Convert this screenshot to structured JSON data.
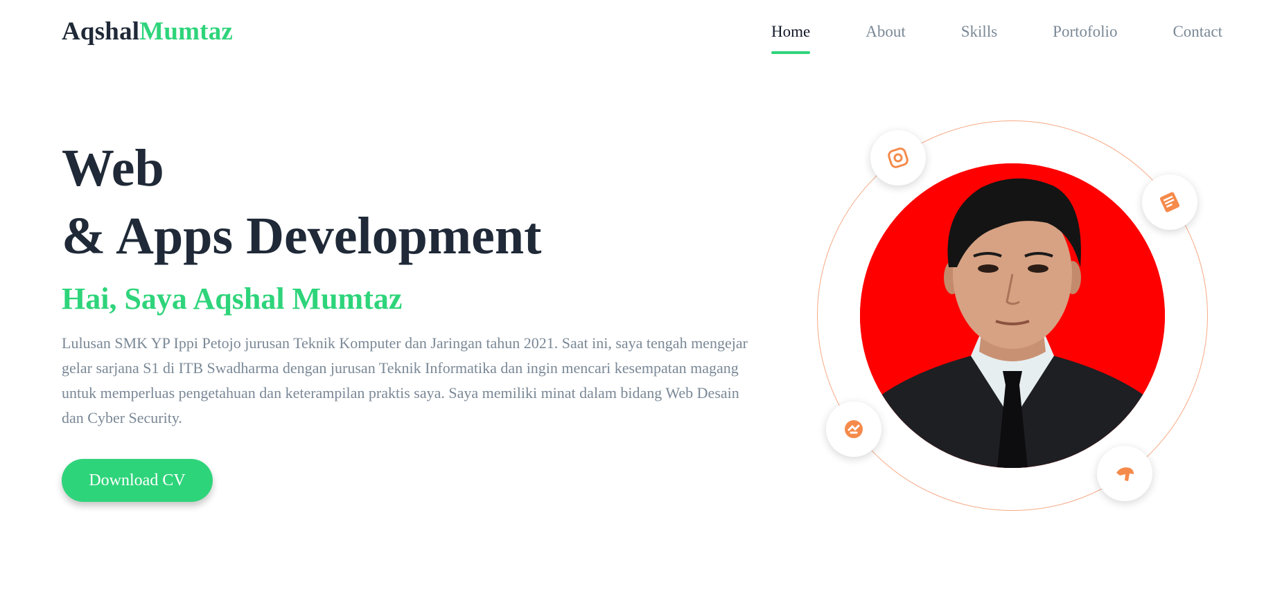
{
  "brand": {
    "first": "Aqshal",
    "second": "Mumtaz",
    "accent_color": "#2ed47a"
  },
  "nav": {
    "items": [
      "Home",
      "About",
      "Skills",
      "Portofolio",
      "Contact"
    ],
    "active": "Home"
  },
  "hero": {
    "title_line1": "Web",
    "title_line2": "& Apps Development",
    "greeting": "Hai, Saya Aqshal Mumtaz",
    "bio": "Lulusan SMK YP Ippi Petojo jurusan Teknik Komputer dan Jaringan tahun 2021. Saat ini, saya tengah mengejar gelar sarjana S1 di ITB Swadharma dengan jurusan Teknik Informatika dan ingin mencari kesempatan magang untuk memperluas pengetahuan dan keterampilan praktis saya. Saya memiliki minat dalam bidang Web Desain dan Cyber Security.",
    "cta_label": "Download CV"
  },
  "profile": {
    "photo_background": "#ff0000",
    "orbit_color": "#f7a985",
    "icon_color": "#f58a4b",
    "icons": [
      "instagram-icon",
      "stackoverflow-icon",
      "codepen-icon",
      "fiverr-icon"
    ]
  }
}
